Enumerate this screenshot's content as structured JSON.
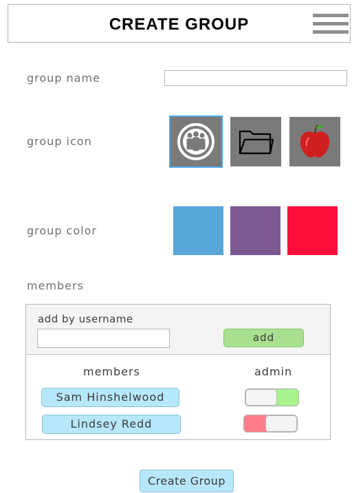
{
  "header": {
    "title": "CREATE GROUP",
    "menu_icon": "hamburger-menu-icon"
  },
  "form": {
    "group_name_label": "group name",
    "group_name_value": "",
    "group_icon_label": "group icon",
    "icons": [
      {
        "name": "people-group-icon",
        "selected": true
      },
      {
        "name": "folder-icon",
        "selected": false
      },
      {
        "name": "apple-icon",
        "selected": false
      }
    ],
    "group_color_label": "group color",
    "colors": [
      "#58a7da",
      "#7c5993",
      "#ff0d3d"
    ],
    "selection_color": "#4aa7e8"
  },
  "members_section": {
    "title": "members",
    "add_by_username_label": "add by username",
    "username_value": "",
    "add_button_label": "add",
    "members_column_header": "members",
    "admin_column_header": "admin",
    "members": [
      {
        "name": "Sam Hinshelwood",
        "admin": true
      },
      {
        "name": "Lindsey Redd",
        "admin": false
      }
    ]
  },
  "footer": {
    "create_button_label": "Create Group"
  }
}
